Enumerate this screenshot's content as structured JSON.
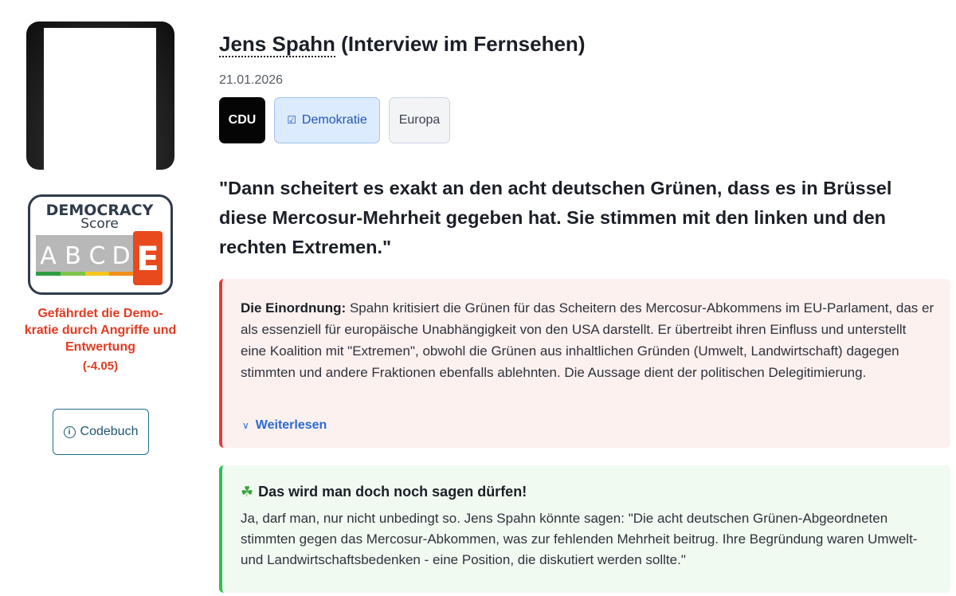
{
  "profile": {
    "photo_icon": "politician-portrait"
  },
  "democracy_score": {
    "title": "DEMOCRACY",
    "subtitle": "Score",
    "grades": [
      "A",
      "B",
      "C",
      "D",
      "E"
    ],
    "active_grade": "E",
    "grade_colors": [
      "#2e9e44",
      "#7fc34a",
      "#f4c51c",
      "#f28f1b",
      "#e94a1d"
    ],
    "verdict": "Gefährdet die Demo-kratie durch Angriffe und Entwertung",
    "value": "(-4.05)"
  },
  "codebuch": {
    "label": "Codebuch",
    "icon": "info-icon"
  },
  "header": {
    "name": "Jens Spahn",
    "context": "(Interview im Fernsehen)",
    "date": "21.01.2026"
  },
  "tags": {
    "party": "CDU",
    "topic": "Demokratie",
    "topic_icon": "ballot-box-icon",
    "region": "Europa"
  },
  "quote": "\"Dann scheitert es exakt an den acht deutschen Grünen, dass es in Brüssel diese Mercosur-Mehrheit gegeben hat. Sie stimmen mit den linken und den rechten Extremen.\"",
  "einordnung": {
    "label": "Die Einordnung:",
    "text": "Spahn kritisiert die Grünen für das Scheitern des Mercosur-Abkommens im EU-Parlament, das er als essenziell für europäische Unabhängigkeit von den USA darstellt. Er übertreibt ihren Einfluss und unterstellt eine Koalition mit \"Extremen\", obwohl die Grünen aus inhaltlichen Gründen (Umwelt, Landwirtschaft) dagegen stimmten und andere Fraktionen ebenfalls ablehnten. Die Aussage dient der politischen Delegitimierung.",
    "more_label": "Weiterlesen",
    "accent": "#e23b3b"
  },
  "alternative": {
    "title": "Das wird man doch noch sagen dürfen!",
    "icon": "four-leaf-clover-icon",
    "text": "Ja, darf man, nur nicht unbedingt so. Jens Spahn könnte sagen: \"Die acht deutschen Grünen-Abgeordneten stimmten gegen das Mercosur-Abkommen, was zur fehlenden Mehrheit beitrug. Ihre Begründung waren Umwelt- und Landwirtschaftsbedenken - eine Position, die diskutiert werden sollte.\"",
    "accent": "#2ebd52"
  }
}
